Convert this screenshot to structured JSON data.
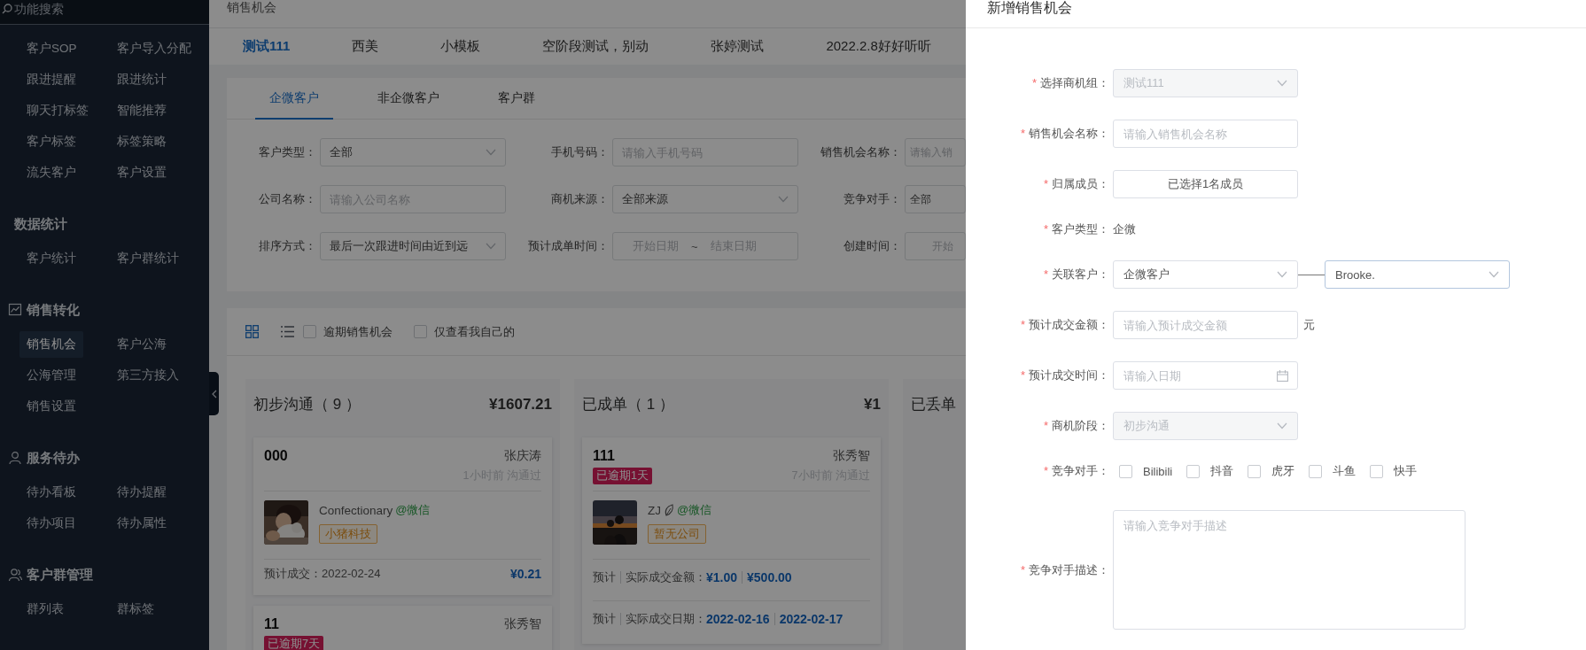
{
  "sidebar": {
    "search": {
      "placeholder": "功能搜索"
    },
    "groups": [
      {
        "items": [
          {
            "label": "客户SOP",
            "selected": false
          },
          {
            "label": "客户导入分配",
            "selected": false
          },
          {
            "label": "跟进提醒",
            "selected": false
          },
          {
            "label": "跟进统计",
            "selected": false
          },
          {
            "label": "聊天打标签",
            "selected": false
          },
          {
            "label": "智能推荐",
            "selected": false
          },
          {
            "label": "客户标签",
            "selected": false
          },
          {
            "label": "标签策略",
            "selected": false
          },
          {
            "label": "流失客户",
            "selected": false
          },
          {
            "label": "客户设置",
            "selected": false
          }
        ]
      },
      {
        "title": "数据统计",
        "items": [
          {
            "label": "客户统计",
            "selected": false
          },
          {
            "label": "客户群统计",
            "selected": false
          }
        ]
      },
      {
        "title": "销售转化",
        "items": [
          {
            "label": "销售机会",
            "selected": true
          },
          {
            "label": "客户公海",
            "selected": false
          },
          {
            "label": "公海管理",
            "selected": false
          },
          {
            "label": "第三方接入",
            "selected": false
          },
          {
            "label": "销售设置",
            "selected": false
          }
        ]
      },
      {
        "title": "服务待办",
        "items": [
          {
            "label": "待办看板",
            "selected": false
          },
          {
            "label": "待办提醒",
            "selected": false
          },
          {
            "label": "待办项目",
            "selected": false
          },
          {
            "label": "待办属性",
            "selected": false
          }
        ]
      },
      {
        "title": "客户群管理",
        "items": [
          {
            "label": "群列表",
            "selected": false
          },
          {
            "label": "群标签",
            "selected": false
          }
        ]
      }
    ]
  },
  "breadcrumb": "销售机会",
  "group_tabs": [
    {
      "label": "测试111",
      "selected": true
    },
    {
      "label": "西美",
      "selected": false
    },
    {
      "label": "小模板",
      "selected": false
    },
    {
      "label": "空阶段测试，别动",
      "selected": false
    },
    {
      "label": "张婷测试",
      "selected": false
    },
    {
      "label": "2022.2.8好好听听",
      "selected": false
    }
  ],
  "filter_panel": {
    "tabs": [
      {
        "label": "企微客户",
        "selected": true
      },
      {
        "label": "非企微客户",
        "selected": false
      },
      {
        "label": "客户群",
        "selected": false
      }
    ],
    "fields": [
      {
        "label": "客户类型：",
        "kind": "select",
        "value": "全部"
      },
      {
        "label": "手机号码：",
        "kind": "input",
        "placeholder": "请输入手机号码"
      },
      {
        "label": "销售机会名称：",
        "kind": "input",
        "placeholder": "请输入销"
      },
      {
        "label": "公司名称：",
        "kind": "input",
        "placeholder": "请输入公司名称"
      },
      {
        "label": "商机来源：",
        "kind": "select",
        "value": "全部来源"
      },
      {
        "label": "竞争对手：",
        "kind": "input",
        "value": "全部"
      },
      {
        "label": "排序方式：",
        "kind": "select",
        "value": "最后一次跟进时间由近到远"
      },
      {
        "label": "预计成单时间：",
        "kind": "daterange",
        "start": "开始日期",
        "separator": "~",
        "end": "结束日期"
      },
      {
        "label": "创建时间：",
        "kind": "daterange",
        "start": "开始"
      }
    ]
  },
  "board": {
    "views": [
      {
        "kind": "grid",
        "selected": true
      },
      {
        "kind": "list",
        "selected": false
      }
    ],
    "filters": [
      {
        "label": "逾期销售机会",
        "checked": false
      },
      {
        "label": "仅查看我自己的",
        "checked": false
      }
    ],
    "columns": [
      {
        "title": "初步沟通（ 9 ）",
        "amount": "¥1607.21",
        "cards": [
          {
            "title": "000",
            "owner": "张庆涛",
            "last_contact": "1小时前 沟通过",
            "contact": {
              "name": "Confectionary",
              "channel": "@微信",
              "company": "小猪科技"
            },
            "footer": [
              {
                "kind": "single",
                "label": "预计成交：2022-02-24",
                "amount": "¥0.21"
              }
            ]
          },
          {
            "title": "11",
            "owner": "张秀智",
            "overdue": "已逾期7天"
          }
        ]
      },
      {
        "title": "已成单（ 1 ）",
        "amount": "¥1",
        "cards": [
          {
            "title": "111",
            "owner": "张秀智",
            "overdue": "已逾期1天",
            "last_contact": "7小时前 沟通过",
            "contact": {
              "name": "ZJ",
              "channel": "@微信",
              "company": "暂无公司"
            },
            "footer": [
              {
                "kind": "compare",
                "prefix": "预计",
                "label": "实际成交金额：",
                "values": [
                  "¥1.00",
                  "¥500.00"
                ]
              },
              {
                "kind": "compare",
                "prefix": "预计",
                "label": "实际成交日期：",
                "values": [
                  "2022-02-16",
                  "2022-02-17"
                ]
              }
            ]
          }
        ]
      },
      {
        "title": "已丢单"
      }
    ]
  },
  "drawer": {
    "title": "新增销售机会",
    "fields": [
      {
        "mark": "*",
        "label": "选择商机组：",
        "kind": "select",
        "value": "测试111",
        "disabled": true
      },
      {
        "mark": "*",
        "label": "销售机会名称：",
        "kind": "input",
        "placeholder": "请输入销售机会名称"
      },
      {
        "mark": "*",
        "label": "归属成员：",
        "kind": "member",
        "value": "已选择1名成员"
      },
      {
        "mark": "*",
        "label": "客户类型：",
        "kind": "text",
        "value": "企微"
      },
      {
        "mark": "*",
        "label": "关联客户：",
        "kind": "select_pair",
        "value": "企微客户",
        "second": {
          "value": "Brooke.",
          "focused": true
        }
      },
      {
        "mark": "*",
        "label": "预计成交金额：",
        "kind": "input",
        "placeholder": "请输入预计成交金额",
        "suffix": "元"
      },
      {
        "mark": "*",
        "label": "预计成交时间：",
        "kind": "date",
        "placeholder": "请输入日期"
      },
      {
        "mark": "*",
        "label": "商机阶段：",
        "kind": "select",
        "value": "初步沟通",
        "disabled": true
      },
      {
        "mark": "*",
        "label": "竞争对手：",
        "kind": "checkboxes",
        "options": [
          {
            "label": "Bilibili",
            "checked": false
          },
          {
            "label": "抖音",
            "checked": false
          },
          {
            "label": "虎牙",
            "checked": false
          },
          {
            "label": "斗鱼",
            "checked": false
          },
          {
            "label": "快手",
            "checked": false
          }
        ]
      },
      {
        "mark": "*",
        "label": "竞争对手描述：",
        "kind": "textarea",
        "placeholder": "请输入竞争对手描述"
      }
    ]
  }
}
